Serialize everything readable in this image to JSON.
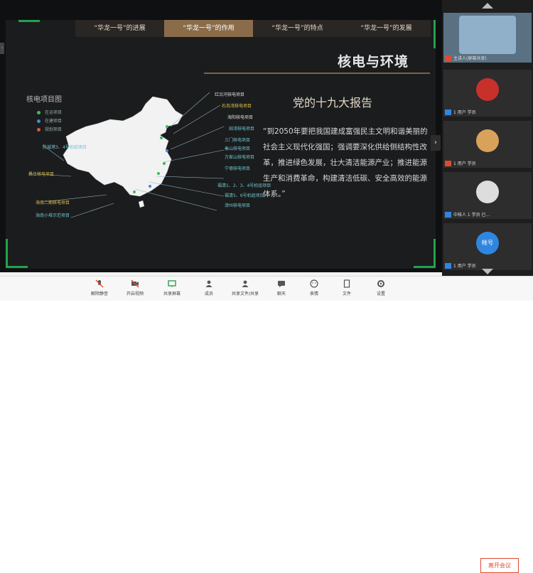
{
  "slide": {
    "tabs": [
      "“华龙一号”的进展",
      "“华龙一号”的作用",
      "“华龙一号”的特点",
      "“华龙一号”的发展"
    ],
    "title": "核电与环境",
    "map_title": "核电项目图",
    "legend": [
      "在运项目",
      "在建项目",
      "规划项目"
    ],
    "report_title": "党的十九大报告",
    "quote": "“到2050年要把我国建成富强民主文明和谐美丽的社会主义现代化强国；强调要深化供给侧结构性改革，推进绿色发展，壮大清洁能源产业；推进能源生产和消费革命，构建清洁低碳、安全高效的能源体系。”",
    "project_labels": [
      "红沿河核电项目",
      "石岛湾核电项目",
      "海阳核电项目",
      "田湾核电项目",
      "三门核电项目",
      "秦山核电项目",
      "方家山核电项目",
      "宁德核电项目",
      "福清1、2、3、4号机组项目",
      "福清5、6号机组项目",
      "漳州核电项目",
      "防城港3、4号机组项目",
      "昌江核电项目",
      "海南二期核电项目",
      "海南小堆示范项目"
    ]
  },
  "sidebar": {
    "participants": [
      {
        "name": "主讲人(屏幕共享)",
        "avatar_color": "#8fb0c8"
      },
      {
        "name": "1 用户 学员",
        "avatar_color": "#c8312a"
      },
      {
        "name": "1 用户 学员",
        "avatar_color": "#d9a25a"
      },
      {
        "name": "中核人 1 学员 已...",
        "avatar_color": "#dddddd"
      },
      {
        "name": "1 用户 学员",
        "avatar_color": "#2f86e0",
        "initials": "帐号"
      }
    ]
  },
  "toolbar": {
    "items": [
      "解除静音",
      "开启视频",
      "共享屏幕",
      "成员",
      "共享文件/共享",
      "聊天",
      "表情",
      "文件",
      "设置"
    ],
    "leave": "离开会议"
  },
  "colors": {
    "accent_green": "#23a24d",
    "tab_active": "#8a6c4a",
    "leave_red": "#e04a2f"
  }
}
